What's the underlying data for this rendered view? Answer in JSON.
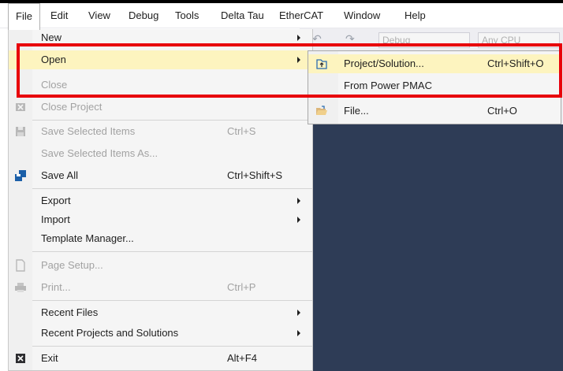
{
  "menubar": {
    "items": [
      {
        "label": "File"
      },
      {
        "label": "Edit"
      },
      {
        "label": "View"
      },
      {
        "label": "Debug"
      },
      {
        "label": "Tools"
      },
      {
        "label": "Delta Tau"
      },
      {
        "label": "EtherCAT"
      },
      {
        "label": "Window"
      },
      {
        "label": "Help"
      }
    ]
  },
  "toolbar": {
    "config_combo": "Debug",
    "platform_combo": "Any CPU"
  },
  "file_menu": {
    "new": {
      "label": "New"
    },
    "open": {
      "label": "Open"
    },
    "close": {
      "label": "Close"
    },
    "close_project": {
      "label": "Close Project"
    },
    "save_selected": {
      "label": "Save Selected Items",
      "shortcut": "Ctrl+S"
    },
    "save_selected_as": {
      "label": "Save Selected Items As..."
    },
    "save_all": {
      "label": "Save All",
      "shortcut": "Ctrl+Shift+S"
    },
    "export": {
      "label": "Export"
    },
    "import": {
      "label": "Import"
    },
    "template_manager": {
      "label": "Template Manager..."
    },
    "page_setup": {
      "label": "Page Setup..."
    },
    "print": {
      "label": "Print...",
      "shortcut": "Ctrl+P"
    },
    "recent_files": {
      "label": "Recent Files"
    },
    "recent_projects": {
      "label": "Recent Projects and Solutions"
    },
    "exit": {
      "label": "Exit",
      "shortcut": "Alt+F4"
    }
  },
  "open_submenu": {
    "project_solution": {
      "label": "Project/Solution...",
      "shortcut": "Ctrl+Shift+O"
    },
    "from_power_pmac": {
      "label": "From Power PMAC"
    },
    "file": {
      "label": "File...",
      "shortcut": "Ctrl+O"
    }
  },
  "colors": {
    "highlight": "#fdf4bf",
    "emphasis_box": "#e8000b",
    "editor_background": "#2e3c56"
  }
}
